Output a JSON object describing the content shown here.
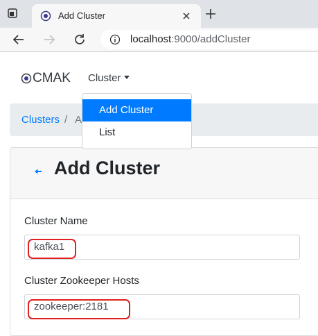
{
  "browser": {
    "tab_title": "Add Cluster",
    "url_host": "localhost",
    "url_rest": ":9000/addCluster"
  },
  "navbar": {
    "brand": "CMAK",
    "menu_label": "Cluster"
  },
  "dropdown": {
    "items": [
      {
        "label": "Add Cluster",
        "active": true
      },
      {
        "label": "List",
        "active": false
      }
    ]
  },
  "breadcrumb": {
    "root": "Clusters",
    "separator": "/",
    "current": "A"
  },
  "page": {
    "title": "Add Cluster",
    "fields": [
      {
        "label": "Cluster Name",
        "value": "kafka1"
      },
      {
        "label": "Cluster Zookeeper Hosts",
        "value": "zookeeper:2181"
      }
    ]
  },
  "colors": {
    "accent": "#007bff",
    "highlight": "#e02020"
  }
}
